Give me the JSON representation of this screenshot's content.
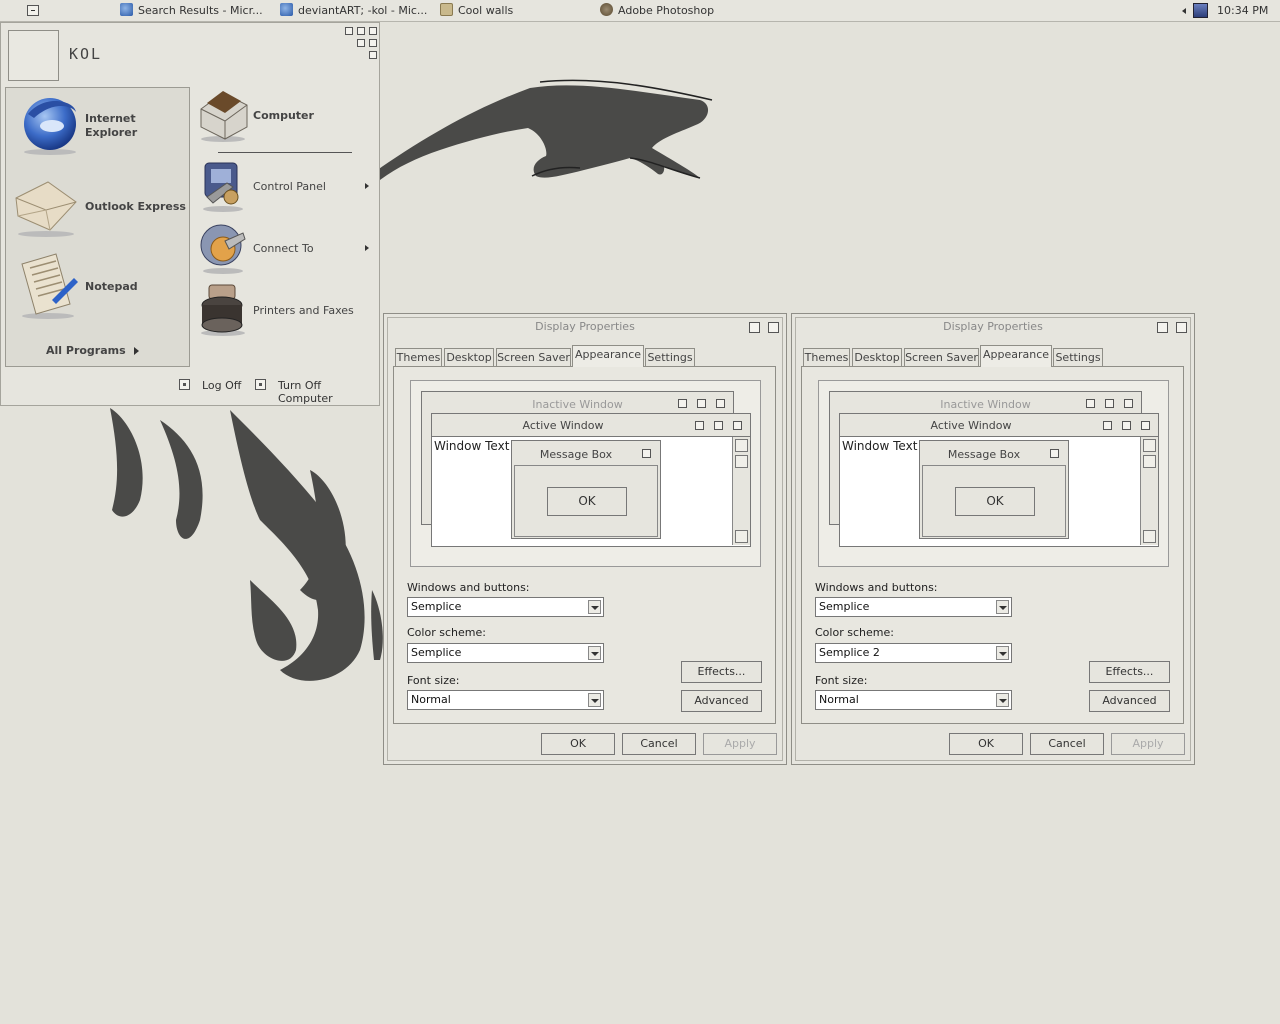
{
  "taskbar": {
    "tasks": [
      {
        "label": "Search Results - Micr...",
        "icon": "internet-explorer-icon"
      },
      {
        "label": "deviantART; -kol - Mic...",
        "icon": "internet-explorer-icon"
      },
      {
        "label": "Cool walls",
        "icon": "folder-icon"
      },
      {
        "label": "Adobe Photoshop",
        "icon": "photoshop-icon"
      }
    ],
    "clock": "10:34 PM"
  },
  "start_menu": {
    "user_name": "KOL",
    "pinned": [
      {
        "label_line1": "Internet",
        "label_line2": "Explorer",
        "icon": "internet-explorer-icon"
      },
      {
        "label": "Outlook Express",
        "icon": "envelope-icon"
      },
      {
        "label": "Notepad",
        "icon": "notepad-icon"
      }
    ],
    "all_programs": "All Programs",
    "right": [
      {
        "label": "Computer",
        "icon": "computer-icon"
      },
      {
        "label": "Control Panel",
        "icon": "control-panel-icon"
      },
      {
        "label": "Connect To",
        "icon": "connect-icon"
      },
      {
        "label": "Printers and Faxes",
        "icon": "printer-icon"
      }
    ],
    "log_off": "Log Off",
    "turn_off": "Turn Off Computer"
  },
  "dialogs": [
    {
      "title": "Display Properties",
      "tabs": [
        "Themes",
        "Desktop",
        "Screen Saver",
        "Appearance",
        "Settings"
      ],
      "active_tab": "Appearance",
      "preview": {
        "inactive": "Inactive Window",
        "active": "Active Window",
        "window_text": "Window Text",
        "message_box": "Message Box",
        "ok": "OK"
      },
      "windows_buttons_label": "Windows and buttons:",
      "windows_buttons_value": "Semplice",
      "color_scheme_label": "Color scheme:",
      "color_scheme_value": "Semplice",
      "font_size_label": "Font size:",
      "font_size_value": "Normal",
      "effects": "Effects...",
      "advanced": "Advanced",
      "ok": "OK",
      "cancel": "Cancel",
      "apply": "Apply"
    },
    {
      "title": "Display Properties",
      "tabs": [
        "Themes",
        "Desktop",
        "Screen Saver",
        "Appearance",
        "Settings"
      ],
      "active_tab": "Appearance",
      "preview": {
        "inactive": "Inactive Window",
        "active": "Active Window",
        "window_text": "Window Text",
        "message_box": "Message Box",
        "ok": "OK"
      },
      "windows_buttons_label": "Windows and buttons:",
      "windows_buttons_value": "Semplice",
      "color_scheme_label": "Color scheme:",
      "color_scheme_value": "Semplice 2",
      "font_size_label": "Font size:",
      "font_size_value": "Normal",
      "effects": "Effects...",
      "advanced": "Advanced",
      "ok": "OK",
      "cancel": "Cancel",
      "apply": "Apply"
    }
  ],
  "colors": {
    "desktop": "#e3e2da",
    "window": "#e6e5de",
    "border": "#8f8e87",
    "wallpaper_ink": "#4a4a48"
  }
}
